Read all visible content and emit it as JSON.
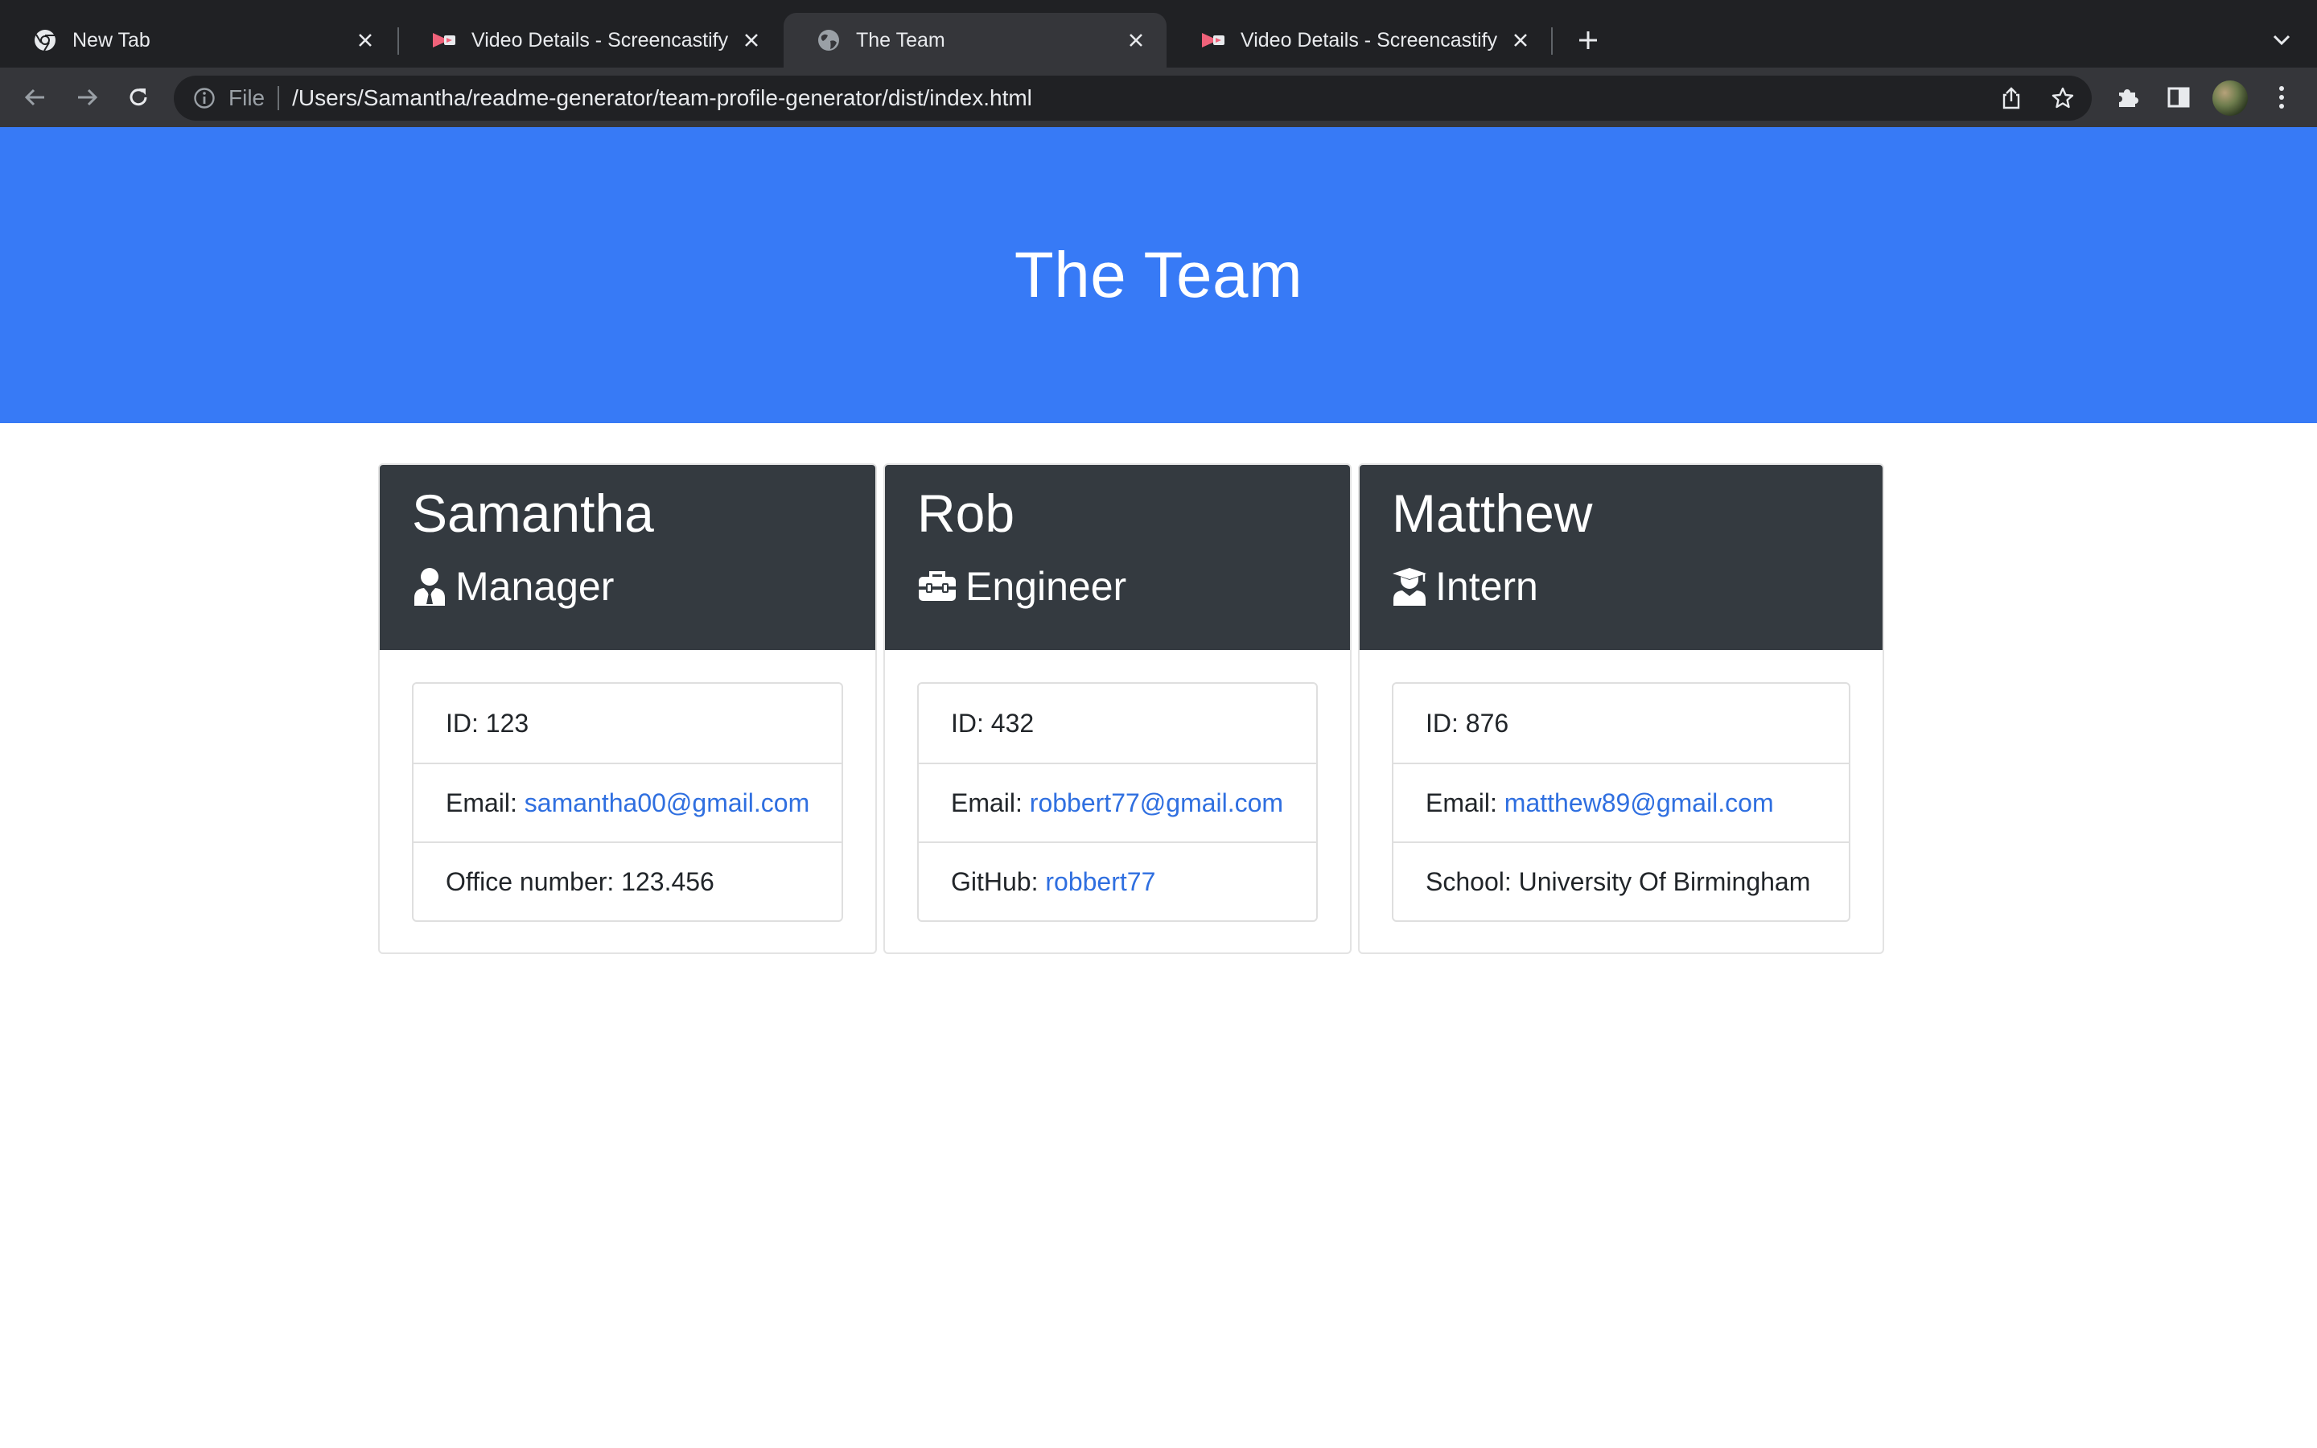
{
  "browser": {
    "tabs": [
      {
        "title": "New Tab",
        "icon": "chrome-icon",
        "active": false
      },
      {
        "title": "Video Details - Screencastify",
        "icon": "screencastify-icon",
        "active": false
      },
      {
        "title": "The Team",
        "icon": "globe-icon",
        "active": true
      },
      {
        "title": "Video Details - Screencastify",
        "icon": "screencastify-icon",
        "active": false
      }
    ],
    "address_bar": {
      "scheme_label": "File",
      "url": "/Users/Samantha/readme-generator/team-profile-generator/dist/index.html"
    }
  },
  "page": {
    "title": "The Team",
    "accent_color": "#377af6",
    "header_color": "#343a40",
    "team": [
      {
        "name": "Samantha",
        "role": "Manager",
        "role_icon": "user-tie-icon",
        "id_text": "ID: 123",
        "email_label": "Email: ",
        "email": "samantha00@gmail.com",
        "extra_label": "Office number: 123.456",
        "extra_link": ""
      },
      {
        "name": "Rob",
        "role": "Engineer",
        "role_icon": "toolbox-icon",
        "id_text": "ID: 432",
        "email_label": "Email: ",
        "email": "robbert77@gmail.com",
        "extra_label": "GitHub: ",
        "extra_link": "robbert77"
      },
      {
        "name": "Matthew",
        "role": "Intern",
        "role_icon": "user-graduate-icon",
        "id_text": "ID: 876",
        "email_label": "Email: ",
        "email": "matthew89@gmail.com",
        "extra_label": "School: University Of Birmingham",
        "extra_link": ""
      }
    ]
  }
}
